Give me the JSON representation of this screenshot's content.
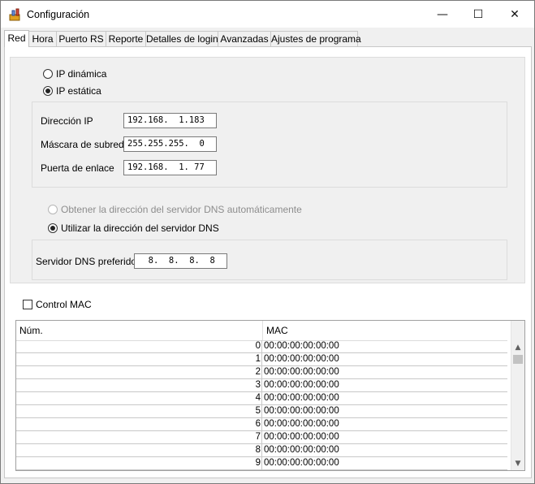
{
  "window": {
    "title": "Configuración",
    "icon": "tools-icon",
    "controls": {
      "minimize": "—",
      "maximize": "☐",
      "close": "✕"
    }
  },
  "tabs": [
    "Red",
    "Hora",
    "Puerto RS",
    "Reporte",
    "Detalles de login",
    "Avanzadas",
    "Ajustes de programa"
  ],
  "active_tab": "Red",
  "ip_mode": {
    "dynamic_label": "IP dinámica",
    "static_label": "IP estática",
    "selected": "static"
  },
  "ip_settings": {
    "ip_label": "Dirección IP",
    "ip_value": "192.168.  1.183",
    "mask_label": "Máscara de subred",
    "mask_value": "255.255.255.  0",
    "gateway_label": "Puerta de enlace",
    "gateway_value": "192.168.  1. 77"
  },
  "dns_mode": {
    "auto_label": "Obtener la dirección del servidor DNS automáticamente",
    "manual_label": "Utilizar la dirección del servidor DNS",
    "selected": "manual"
  },
  "dns_settings": {
    "preferred_label": "Servidor DNS preferido",
    "preferred_value": "  8.  8.  8.  8"
  },
  "mac_control": {
    "label": "Control MAC",
    "checked": false
  },
  "mac_table": {
    "columns": [
      "Núm.",
      "MAC"
    ],
    "rows": [
      {
        "num": "0",
        "mac": "00:00:00:00:00:00"
      },
      {
        "num": "1",
        "mac": "00:00:00:00:00:00"
      },
      {
        "num": "2",
        "mac": "00:00:00:00:00:00"
      },
      {
        "num": "3",
        "mac": "00:00:00:00:00:00"
      },
      {
        "num": "4",
        "mac": "00:00:00:00:00:00"
      },
      {
        "num": "5",
        "mac": "00:00:00:00:00:00"
      },
      {
        "num": "6",
        "mac": "00:00:00:00:00:00"
      },
      {
        "num": "7",
        "mac": "00:00:00:00:00:00"
      },
      {
        "num": "8",
        "mac": "00:00:00:00:00:00"
      },
      {
        "num": "9",
        "mac": "00:00:00:00:00:00"
      }
    ]
  }
}
